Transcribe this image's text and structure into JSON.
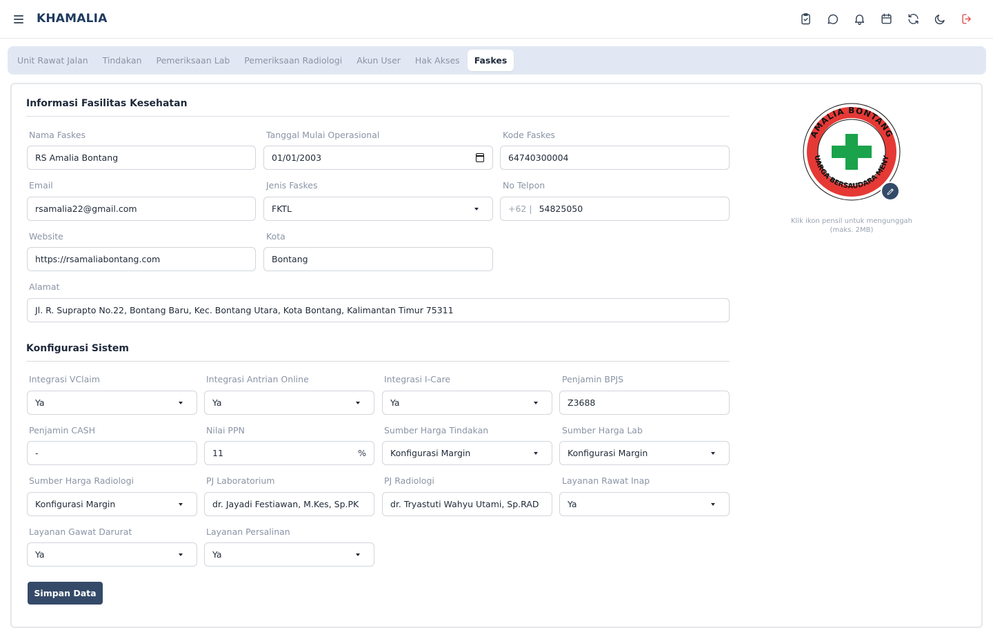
{
  "app": {
    "title": "KHAMALIA"
  },
  "header_icons": [
    "clipboard-check-icon",
    "chat-icon",
    "bell-icon",
    "calendar-icon",
    "refresh-icon",
    "moon-icon",
    "logout-icon"
  ],
  "tabs": [
    {
      "label": "Unit Rawat Jalan",
      "active": false
    },
    {
      "label": "Tindakan",
      "active": false
    },
    {
      "label": "Pemeriksaan Lab",
      "active": false
    },
    {
      "label": "Pemeriksaan Radiologi",
      "active": false
    },
    {
      "label": "Akun User",
      "active": false
    },
    {
      "label": "Hak Akses",
      "active": false
    },
    {
      "label": "Faskes",
      "active": true
    }
  ],
  "info": {
    "title": "Informasi Fasilitas Kesehatan",
    "nama_faskes": {
      "label": "Nama Faskes",
      "value": "RS Amalia Bontang"
    },
    "tanggal": {
      "label": "Tanggal Mulai Operasional",
      "value": "01/01/2003"
    },
    "kode": {
      "label": "Kode Faskes",
      "value": "64740300004"
    },
    "email": {
      "label": "Email",
      "value": "rsamalia22@gmail.com"
    },
    "jenis": {
      "label": "Jenis Faskes",
      "value": "FKTL"
    },
    "telpon": {
      "label": "No Telpon",
      "prefix": "+62  |",
      "value": "54825050"
    },
    "website": {
      "label": "Website",
      "value": "https://rsamaliabontang.com"
    },
    "kota": {
      "label": "Kota",
      "value": "Bontang"
    },
    "alamat": {
      "label": "Alamat",
      "value": "Jl. R. Suprapto No.22, Bontang Baru, Kec. Bontang Utara, Kota Bontang, Kalimantan Timur 75311"
    }
  },
  "logo": {
    "text_top": "AMALIA BONTANG",
    "text_bottom": "KELUARGA BERSAUDARA MENYATU",
    "hint": "Klik ikon pensil untuk mengunggah (maks. 2MB)",
    "ring_color": "#e53935",
    "cross_color": "#1aa34a"
  },
  "config": {
    "title": "Konfigurasi Sistem",
    "vclaim": {
      "label": "Integrasi VClaim",
      "value": "Ya"
    },
    "antrian": {
      "label": "Integrasi Antrian Online",
      "value": "Ya"
    },
    "icare": {
      "label": "Integrasi I-Care",
      "value": "Ya"
    },
    "bpjs": {
      "label": "Penjamin BPJS",
      "value": "Z3688"
    },
    "cash": {
      "label": "Penjamin CASH",
      "value": "-"
    },
    "ppn": {
      "label": "Nilai PPN",
      "value": "11",
      "suffix": "%"
    },
    "harga_tindakan": {
      "label": "Sumber Harga Tindakan",
      "value": "Konfigurasi Margin"
    },
    "harga_lab": {
      "label": "Sumber Harga Lab",
      "value": "Konfigurasi Margin"
    },
    "harga_radiologi": {
      "label": "Sumber Harga Radiologi",
      "value": "Konfigurasi Margin"
    },
    "pj_lab": {
      "label": "PJ Laboratorium",
      "value": "dr. Jayadi Festiawan, M.Kes, Sp.PK"
    },
    "pj_radiologi": {
      "label": "PJ Radiologi",
      "value": "dr. Tryastuti Wahyu Utami, Sp.RAD"
    },
    "rawat_inap": {
      "label": "Layanan Rawat Inap",
      "value": "Ya"
    },
    "gawat_darurat": {
      "label": "Layanan Gawat Darurat",
      "value": "Ya"
    },
    "persalinan": {
      "label": "Layanan Persalinan",
      "value": "Ya"
    }
  },
  "actions": {
    "save_label": "Simpan Data"
  }
}
